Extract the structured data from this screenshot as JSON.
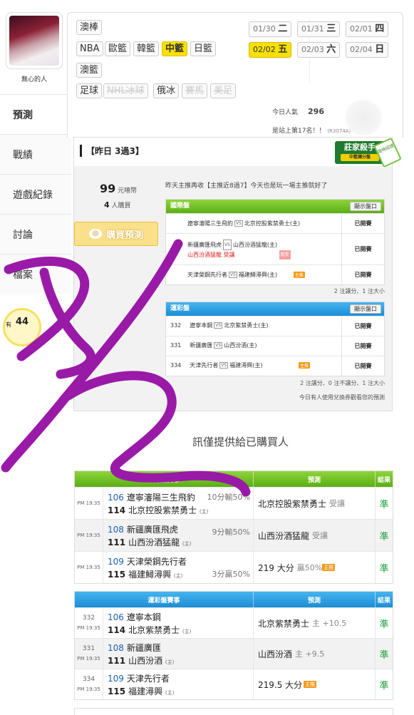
{
  "user": {
    "name": "無心的人"
  },
  "nav": {
    "items": [
      {
        "label": "預測"
      },
      {
        "label": "戰績"
      },
      {
        "label": "遊戲紀錄"
      },
      {
        "label": "討論"
      },
      {
        "label": "檔案"
      }
    ]
  },
  "sports": {
    "row1": [
      "澳棒"
    ],
    "row2": [
      "NBA",
      "歐籃",
      "韓籃",
      "中籃",
      "日籃"
    ],
    "row3": [
      "澳籃"
    ],
    "row4": [
      "足球",
      "NHL冰球",
      "俄冰",
      "賽馬",
      "美足"
    ],
    "active": "中籃"
  },
  "dates": [
    {
      "md": "01/30",
      "wd": "二"
    },
    {
      "md": "01/31",
      "wd": "三"
    },
    {
      "md": "02/01",
      "wd": "四"
    },
    {
      "md": "02/02",
      "wd": "五"
    },
    {
      "md": "02/03",
      "wd": "六"
    },
    {
      "md": "02/04",
      "wd": "日"
    }
  ],
  "stats": {
    "popularity_label": "今日人氣",
    "popularity": "296",
    "rank_text": "是站上第17名！！",
    "rank_code": "(R3074A)"
  },
  "card": {
    "title": "【昨日 3過3】",
    "price": "99",
    "price_unit": "元嘻幣",
    "buyers": "4",
    "buyers_unit": "人購買",
    "buy_button": "購買預測",
    "intro": "昨天主推再收【主推近8過7】今天也是玩一場主推就好了",
    "badge": "莊家殺手",
    "badge_sub": "中籃讓分盤",
    "ribbon": "限時認證",
    "intl": {
      "title": "國際盤",
      "show": "顯示盤口",
      "rows": [
        {
          "home": "遼寧瀋陽三生飛豹",
          "away": "北京控股紫禁勇士(主)",
          "res": "已開賽"
        },
        {
          "home": "新疆廣匯飛虎",
          "away": "山西汾酒猛龍(主)",
          "pick": "山西汾酒猛龍 受讓",
          "tag": "殺受",
          "res": "已開賽"
        },
        {
          "home": "天津榮鋼先行者",
          "away": "福建鱘潯興(主)",
          "tag": "主推",
          "res": "已開賽"
        }
      ],
      "note": "2 注讓分、1 注大小"
    },
    "lottery": {
      "title": "運彩盤",
      "show": "顯示盤口",
      "rows": [
        {
          "id": "332",
          "home": "遼寧本鋼",
          "away": "北京紫禁勇士(主)",
          "res": "已開賽"
        },
        {
          "id": "331",
          "home": "新疆廣匯",
          "away": "山西汾酒(主)",
          "res": "已開賽"
        },
        {
          "id": "334",
          "home": "天津先行者",
          "away": "福建潯興(主)",
          "tag": "主推",
          "res": "已開賽"
        }
      ],
      "note": "2 注讓分、0 注不讓分、1 注大小",
      "note2": "今日有人使用兌換券觀看您的預測"
    }
  },
  "info_text": "訊僅提供給已購買人",
  "intl_table": {
    "headers": [
      "國際盤賽事",
      "預測",
      "結果"
    ],
    "rows": [
      {
        "time": "PM 19:35",
        "n1": "106",
        "t1": "遼寧瀋陽三生飛豹",
        "n2": "114",
        "t2": "北京控股紫禁勇士",
        "h": "(主)",
        "odds": "10分輸50%",
        "pred": "北京控股紫禁勇士",
        "pred_g": "受讓",
        "res": "準"
      },
      {
        "time": "PM 19:35",
        "n1": "108",
        "t1": "新疆廣匯飛虎",
        "n2": "111",
        "t2": "山西汾酒猛龍",
        "h": "(主)",
        "odds": "9分輸50%",
        "pred": "山西汾酒猛龍",
        "pred_g": "受讓",
        "res": "準"
      },
      {
        "time": "PM 19:35",
        "n1": "109",
        "t1": "天津榮鋼先行者",
        "n2": "115",
        "t2": "福建鱘潯興",
        "h": "(主)",
        "odds": "3分贏50%",
        "pred": "219 大分",
        "pred_g": "贏50%",
        "tag": "主推",
        "res": "準"
      }
    ]
  },
  "lottery_table": {
    "headers": [
      "運彩盤賽事",
      "預測",
      "結果"
    ],
    "rows": [
      {
        "id": "332",
        "time": "PM 19:35",
        "n1": "106",
        "t1": "遼寧本鋼",
        "n2": "114",
        "t2": "北京紫禁勇士",
        "h": "(主)",
        "pred": "北京紫禁勇士",
        "pred_g": "主 +10.5",
        "res": "準"
      },
      {
        "id": "331",
        "time": "PM 19:35",
        "n1": "108",
        "t1": "新疆廣匯",
        "n2": "111",
        "t2": "山西汾酒",
        "h": "(主)",
        "pred": "山西汾酒",
        "pred_g": "主 +9.5",
        "res": "準"
      },
      {
        "id": "334",
        "time": "PM 19:35",
        "n1": "109",
        "t1": "天津先行者",
        "n2": "115",
        "t2": "福建潯興",
        "h": "(主)",
        "pred": "219.5 大分",
        "tag": "主推",
        "res": "準"
      }
    ]
  },
  "sidebar_partial": {
    "num": "44",
    "prefix": "有"
  },
  "colors": {
    "accent": "#f8e000",
    "green": "#5aae14",
    "blue": "#1a8ed6",
    "scribble": "#9a1aa8",
    "win": "#1aa03a"
  }
}
